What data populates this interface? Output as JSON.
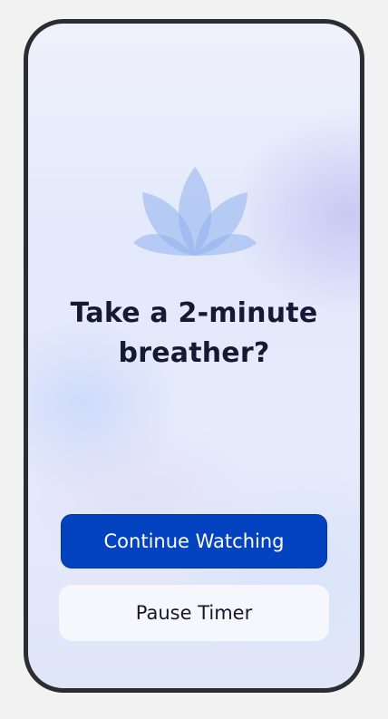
{
  "prompt": {
    "title_line1": "Take a 2-minute",
    "title_line2": "breather?"
  },
  "actions": {
    "primary_label": "Continue Watching",
    "secondary_label": "Pause Timer"
  },
  "icon": {
    "name": "lotus-icon",
    "color": "#8fb0ef"
  },
  "colors": {
    "primary_button": "#0443c0",
    "title_text": "#141a33",
    "frame": "#2b2d33"
  }
}
